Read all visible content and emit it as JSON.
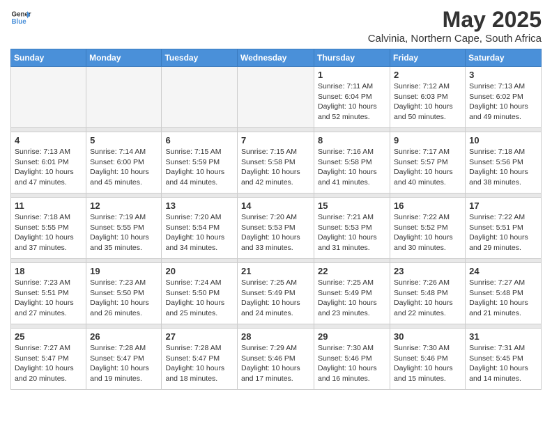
{
  "header": {
    "logo_line1": "General",
    "logo_line2": "Blue",
    "month": "May 2025",
    "location": "Calvinia, Northern Cape, South Africa"
  },
  "weekdays": [
    "Sunday",
    "Monday",
    "Tuesday",
    "Wednesday",
    "Thursday",
    "Friday",
    "Saturday"
  ],
  "weeks": [
    {
      "days": [
        {
          "num": "",
          "info": ""
        },
        {
          "num": "",
          "info": ""
        },
        {
          "num": "",
          "info": ""
        },
        {
          "num": "",
          "info": ""
        },
        {
          "num": "1",
          "info": "Sunrise: 7:11 AM\nSunset: 6:04 PM\nDaylight: 10 hours\nand 52 minutes."
        },
        {
          "num": "2",
          "info": "Sunrise: 7:12 AM\nSunset: 6:03 PM\nDaylight: 10 hours\nand 50 minutes."
        },
        {
          "num": "3",
          "info": "Sunrise: 7:13 AM\nSunset: 6:02 PM\nDaylight: 10 hours\nand 49 minutes."
        }
      ]
    },
    {
      "days": [
        {
          "num": "4",
          "info": "Sunrise: 7:13 AM\nSunset: 6:01 PM\nDaylight: 10 hours\nand 47 minutes."
        },
        {
          "num": "5",
          "info": "Sunrise: 7:14 AM\nSunset: 6:00 PM\nDaylight: 10 hours\nand 45 minutes."
        },
        {
          "num": "6",
          "info": "Sunrise: 7:15 AM\nSunset: 5:59 PM\nDaylight: 10 hours\nand 44 minutes."
        },
        {
          "num": "7",
          "info": "Sunrise: 7:15 AM\nSunset: 5:58 PM\nDaylight: 10 hours\nand 42 minutes."
        },
        {
          "num": "8",
          "info": "Sunrise: 7:16 AM\nSunset: 5:58 PM\nDaylight: 10 hours\nand 41 minutes."
        },
        {
          "num": "9",
          "info": "Sunrise: 7:17 AM\nSunset: 5:57 PM\nDaylight: 10 hours\nand 40 minutes."
        },
        {
          "num": "10",
          "info": "Sunrise: 7:18 AM\nSunset: 5:56 PM\nDaylight: 10 hours\nand 38 minutes."
        }
      ]
    },
    {
      "days": [
        {
          "num": "11",
          "info": "Sunrise: 7:18 AM\nSunset: 5:55 PM\nDaylight: 10 hours\nand 37 minutes."
        },
        {
          "num": "12",
          "info": "Sunrise: 7:19 AM\nSunset: 5:55 PM\nDaylight: 10 hours\nand 35 minutes."
        },
        {
          "num": "13",
          "info": "Sunrise: 7:20 AM\nSunset: 5:54 PM\nDaylight: 10 hours\nand 34 minutes."
        },
        {
          "num": "14",
          "info": "Sunrise: 7:20 AM\nSunset: 5:53 PM\nDaylight: 10 hours\nand 33 minutes."
        },
        {
          "num": "15",
          "info": "Sunrise: 7:21 AM\nSunset: 5:53 PM\nDaylight: 10 hours\nand 31 minutes."
        },
        {
          "num": "16",
          "info": "Sunrise: 7:22 AM\nSunset: 5:52 PM\nDaylight: 10 hours\nand 30 minutes."
        },
        {
          "num": "17",
          "info": "Sunrise: 7:22 AM\nSunset: 5:51 PM\nDaylight: 10 hours\nand 29 minutes."
        }
      ]
    },
    {
      "days": [
        {
          "num": "18",
          "info": "Sunrise: 7:23 AM\nSunset: 5:51 PM\nDaylight: 10 hours\nand 27 minutes."
        },
        {
          "num": "19",
          "info": "Sunrise: 7:23 AM\nSunset: 5:50 PM\nDaylight: 10 hours\nand 26 minutes."
        },
        {
          "num": "20",
          "info": "Sunrise: 7:24 AM\nSunset: 5:50 PM\nDaylight: 10 hours\nand 25 minutes."
        },
        {
          "num": "21",
          "info": "Sunrise: 7:25 AM\nSunset: 5:49 PM\nDaylight: 10 hours\nand 24 minutes."
        },
        {
          "num": "22",
          "info": "Sunrise: 7:25 AM\nSunset: 5:49 PM\nDaylight: 10 hours\nand 23 minutes."
        },
        {
          "num": "23",
          "info": "Sunrise: 7:26 AM\nSunset: 5:48 PM\nDaylight: 10 hours\nand 22 minutes."
        },
        {
          "num": "24",
          "info": "Sunrise: 7:27 AM\nSunset: 5:48 PM\nDaylight: 10 hours\nand 21 minutes."
        }
      ]
    },
    {
      "days": [
        {
          "num": "25",
          "info": "Sunrise: 7:27 AM\nSunset: 5:47 PM\nDaylight: 10 hours\nand 20 minutes."
        },
        {
          "num": "26",
          "info": "Sunrise: 7:28 AM\nSunset: 5:47 PM\nDaylight: 10 hours\nand 19 minutes."
        },
        {
          "num": "27",
          "info": "Sunrise: 7:28 AM\nSunset: 5:47 PM\nDaylight: 10 hours\nand 18 minutes."
        },
        {
          "num": "28",
          "info": "Sunrise: 7:29 AM\nSunset: 5:46 PM\nDaylight: 10 hours\nand 17 minutes."
        },
        {
          "num": "29",
          "info": "Sunrise: 7:30 AM\nSunset: 5:46 PM\nDaylight: 10 hours\nand 16 minutes."
        },
        {
          "num": "30",
          "info": "Sunrise: 7:30 AM\nSunset: 5:46 PM\nDaylight: 10 hours\nand 15 minutes."
        },
        {
          "num": "31",
          "info": "Sunrise: 7:31 AM\nSunset: 5:45 PM\nDaylight: 10 hours\nand 14 minutes."
        }
      ]
    }
  ]
}
